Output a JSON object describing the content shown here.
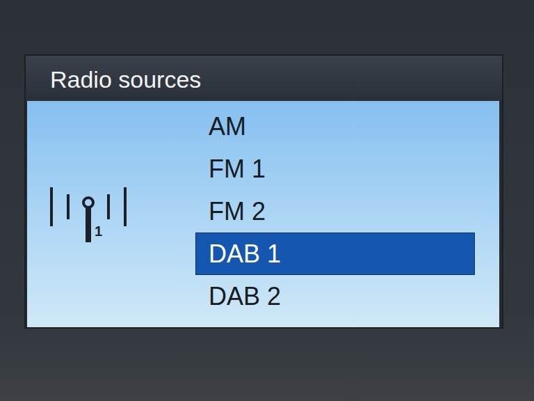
{
  "screen": {
    "title": "Radio sources"
  },
  "source_icon": {
    "badge": "1"
  },
  "sources": [
    {
      "label": "AM",
      "selected": false
    },
    {
      "label": "FM 1",
      "selected": false
    },
    {
      "label": "FM 2",
      "selected": false
    },
    {
      "label": "DAB 1",
      "selected": true
    },
    {
      "label": "DAB 2",
      "selected": false
    }
  ]
}
